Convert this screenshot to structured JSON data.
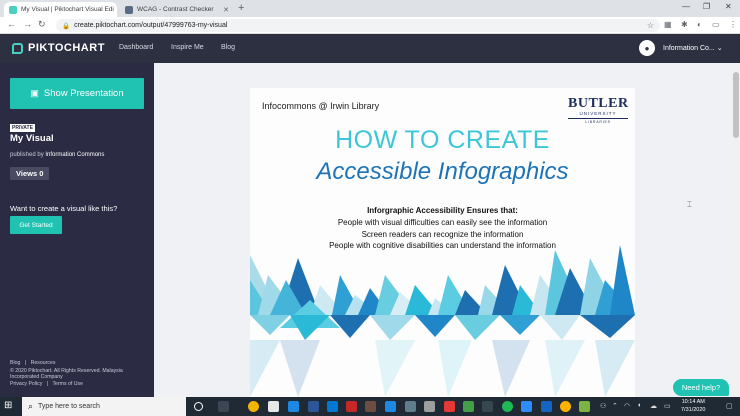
{
  "browser": {
    "tabs": [
      {
        "title": "My Visual | Piktochart Visual Edi",
        "active": true
      },
      {
        "title": "WCAG - Contrast Checker",
        "active": false
      }
    ],
    "url": "create.piktochart.com/output/47999763-my-visual"
  },
  "header": {
    "brand": "PIKTOCHART",
    "nav": [
      "Dashboard",
      "Inspire Me",
      "Blog"
    ],
    "account": "Information Co..."
  },
  "sidebar": {
    "show_presentation": "Show Presentation",
    "badge": "PRIVATE",
    "title": "My Visual",
    "published_by_prefix": "published by",
    "publisher": "Information Commons",
    "views": "Views 0",
    "cta_text": "Want to create a visual like this?",
    "cta_button": "Get Started",
    "footer": {
      "links1": [
        "Blog",
        "Resources"
      ],
      "copyright1": "© 2020 Piktochart. All Rights Reserved. Malaysia",
      "copyright2": "Incorporated Company",
      "links2": [
        "Privacy Policy",
        "Terms of Use"
      ]
    }
  },
  "poster": {
    "library": "Infocommons @ Irwin Library",
    "logo_line1": "BUTLER",
    "logo_line2": "UNIVERSITY",
    "logo_line3": "LIBRARIES",
    "heading1": "HOW TO CREATE",
    "heading2": "Accessible Infographics",
    "ensures": "Inforgraphic Accessibility Ensures that:",
    "points": [
      "People with visual difficulties can easily see the information",
      "Screen readers can recognize the information",
      "People with cognitive disabilities can understand the information"
    ]
  },
  "help_button": "Need help?",
  "taskbar": {
    "search_placeholder": "Type here to search",
    "time": "10:14 AM",
    "date": "7/31/2020"
  }
}
